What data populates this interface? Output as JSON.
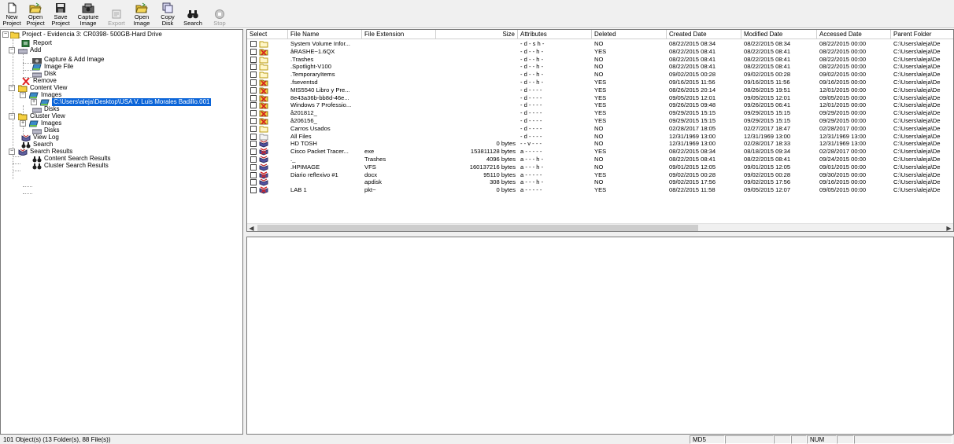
{
  "toolbar": {
    "buttons": [
      {
        "label": "New\nProject",
        "icon": "new-project-icon",
        "enabled": true
      },
      {
        "label": "Open\nProject",
        "icon": "open-project-icon",
        "enabled": true
      },
      {
        "label": "Save\nProject",
        "icon": "save-project-icon",
        "enabled": true
      },
      {
        "label": "Capture\nImage",
        "icon": "capture-image-icon",
        "enabled": true
      },
      {
        "label": "Export",
        "icon": "export-icon",
        "enabled": false
      },
      {
        "label": "Open\nImage",
        "icon": "open-image-icon",
        "enabled": true
      },
      {
        "label": "Copy\nDisk",
        "icon": "copy-disk-icon",
        "enabled": true
      },
      {
        "label": "Search",
        "icon": "binoculars-icon",
        "enabled": true
      },
      {
        "label": "Stop",
        "icon": "stop-icon",
        "enabled": false
      }
    ]
  },
  "tree": {
    "project": "Project - Evidencia 3: CR0398- 500GB-Hard Drive",
    "report": "Report",
    "add": "Add",
    "capture_add_image": "Capture & Add Image",
    "image_file": "Image File",
    "disk": "Disk",
    "remove": "Remove",
    "content_view": "Content View",
    "images": "Images",
    "selected_image": "C:\\Users\\aleja\\Desktop\\USA V. Luis Morales Badillo.001",
    "disks": "Disks",
    "cluster_view": "Cluster View",
    "cluster_images": "Images",
    "cluster_disks": "Disks",
    "view_log": "View Log",
    "search": "Search",
    "search_results": "Search Results",
    "content_search_results": "Content Search Results",
    "cluster_search_results": "Cluster Search Results"
  },
  "file_list": {
    "columns": [
      "Select",
      "File Name",
      "File Extension",
      "Size",
      "Attributes",
      "Deleted",
      "Created Date",
      "Modified Date",
      "Accessed Date",
      "Parent Folder"
    ],
    "rows": [
      {
        "icon": "folder",
        "name": "System Volume Infor...",
        "ext": "",
        "size": "",
        "attr": "- d - s h -",
        "deleted": "NO",
        "created": "08/22/2015 08:34",
        "modified": "08/22/2015 08:34",
        "accessed": "08/22/2015 00:00",
        "parent": "C:\\Users\\aleja\\De"
      },
      {
        "icon": "folder-deleted",
        "name": "åRASHE~1.6QX",
        "ext": "",
        "size": "",
        "attr": "- d - - h -",
        "deleted": "YES",
        "created": "08/22/2015 08:41",
        "modified": "08/22/2015 08:41",
        "accessed": "08/22/2015 00:00",
        "parent": "C:\\Users\\aleja\\De"
      },
      {
        "icon": "folder",
        "name": ".Trashes",
        "ext": "",
        "size": "",
        "attr": "- d - - h -",
        "deleted": "NO",
        "created": "08/22/2015 08:41",
        "modified": "08/22/2015 08:41",
        "accessed": "08/22/2015 00:00",
        "parent": "C:\\Users\\aleja\\De"
      },
      {
        "icon": "folder",
        "name": ".Spotlight-V100",
        "ext": "",
        "size": "",
        "attr": "- d - - h -",
        "deleted": "NO",
        "created": "08/22/2015 08:41",
        "modified": "08/22/2015 08:41",
        "accessed": "08/22/2015 00:00",
        "parent": "C:\\Users\\aleja\\De"
      },
      {
        "icon": "folder",
        "name": ".TemporaryItems",
        "ext": "",
        "size": "",
        "attr": "- d - - h -",
        "deleted": "NO",
        "created": "09/02/2015 00:28",
        "modified": "09/02/2015 00:28",
        "accessed": "09/02/2015 00:00",
        "parent": "C:\\Users\\aleja\\De"
      },
      {
        "icon": "folder-deleted",
        "name": ".fseventsd",
        "ext": "",
        "size": "",
        "attr": "- d - - h -",
        "deleted": "YES",
        "created": "09/16/2015 11:56",
        "modified": "09/16/2015 11:56",
        "accessed": "09/16/2015 00:00",
        "parent": "C:\\Users\\aleja\\De"
      },
      {
        "icon": "folder-deleted",
        "name": "MIS5540 Libro y Pre...",
        "ext": "",
        "size": "",
        "attr": "- d - - - -",
        "deleted": "YES",
        "created": "08/26/2015 20:14",
        "modified": "08/26/2015 19:51",
        "accessed": "12/01/2015 00:00",
        "parent": "C:\\Users\\aleja\\De"
      },
      {
        "icon": "folder-deleted",
        "name": "8e43a36b-bb8d-46e...",
        "ext": "",
        "size": "",
        "attr": "- d - - - -",
        "deleted": "YES",
        "created": "09/05/2015 12:01",
        "modified": "09/05/2015 12:01",
        "accessed": "09/05/2015 00:00",
        "parent": "C:\\Users\\aleja\\De"
      },
      {
        "icon": "folder-deleted",
        "name": "Windows 7 Professio...",
        "ext": "",
        "size": "",
        "attr": "- d - - - -",
        "deleted": "YES",
        "created": "09/26/2015 09:48",
        "modified": "09/26/2015 06:41",
        "accessed": "12/01/2015 00:00",
        "parent": "C:\\Users\\aleja\\De"
      },
      {
        "icon": "folder-deleted",
        "name": "å201812_",
        "ext": "",
        "size": "",
        "attr": "- d - - - -",
        "deleted": "YES",
        "created": "09/29/2015 15:15",
        "modified": "09/29/2015 15:15",
        "accessed": "09/29/2015 00:00",
        "parent": "C:\\Users\\aleja\\De"
      },
      {
        "icon": "folder-deleted",
        "name": "å206156_",
        "ext": "",
        "size": "",
        "attr": "- d - - - -",
        "deleted": "YES",
        "created": "09/29/2015 15:15",
        "modified": "09/29/2015 15:15",
        "accessed": "09/29/2015 00:00",
        "parent": "C:\\Users\\aleja\\De"
      },
      {
        "icon": "folder",
        "name": "Carros Usados",
        "ext": "",
        "size": "",
        "attr": "- d - - - -",
        "deleted": "NO",
        "created": "02/28/2017 18:05",
        "modified": "02/27/2017 18:47",
        "accessed": "02/28/2017 00:00",
        "parent": "C:\\Users\\aleja\\De"
      },
      {
        "icon": "folder-gray",
        "name": "All Files",
        "ext": "",
        "size": "",
        "attr": "- d - - - -",
        "deleted": "NO",
        "created": "12/31/1969 13:00",
        "modified": "12/31/1969 13:00",
        "accessed": "12/31/1969 13:00",
        "parent": "C:\\Users\\aleja\\De"
      },
      {
        "icon": "file",
        "name": "HD TOSH",
        "ext": "",
        "size": "0 bytes",
        "attr": "- - v - - -",
        "deleted": "NO",
        "created": "12/31/1969 13:00",
        "modified": "02/28/2017 18:33",
        "accessed": "12/31/1969 13:00",
        "parent": "C:\\Users\\aleja\\De"
      },
      {
        "icon": "file-deleted",
        "name": "Cisco Packet Tracer...",
        "ext": "exe",
        "size": "153811128 bytes",
        "attr": "a - - - - -",
        "deleted": "YES",
        "created": "08/22/2015 08:34",
        "modified": "08/18/2015 09:34",
        "accessed": "02/28/2017 00:00",
        "parent": "C:\\Users\\aleja\\De"
      },
      {
        "icon": "file",
        "name": "._",
        "ext": "Trashes",
        "size": "4096 bytes",
        "attr": "a - - - h -",
        "deleted": "NO",
        "created": "08/22/2015 08:41",
        "modified": "08/22/2015 08:41",
        "accessed": "09/24/2015 00:00",
        "parent": "C:\\Users\\aleja\\De"
      },
      {
        "icon": "file",
        "name": ".HPIMAGE",
        "ext": "VFS",
        "size": "160137216 bytes",
        "attr": "a - - - h -",
        "deleted": "NO",
        "created": "09/01/2015 12:05",
        "modified": "09/01/2015 12:05",
        "accessed": "09/01/2015 00:00",
        "parent": "C:\\Users\\aleja\\De"
      },
      {
        "icon": "file-deleted",
        "name": "Diario reflexivo #1",
        "ext": "docx",
        "size": "95110 bytes",
        "attr": "a - - - - -",
        "deleted": "YES",
        "created": "09/02/2015 00:28",
        "modified": "09/02/2015 00:28",
        "accessed": "09/30/2015 00:00",
        "parent": "C:\\Users\\aleja\\De"
      },
      {
        "icon": "file",
        "name": "",
        "ext": "apdisk",
        "size": "308 bytes",
        "attr": "a - - - h -",
        "deleted": "NO",
        "created": "09/02/2015 17:56",
        "modified": "09/02/2015 17:56",
        "accessed": "09/16/2015 00:00",
        "parent": "C:\\Users\\aleja\\De"
      },
      {
        "icon": "file-deleted",
        "name": "LAB 1",
        "ext": "pkt~",
        "size": "0 bytes",
        "attr": "a - - - - -",
        "deleted": "YES",
        "created": "08/22/2015 11:58",
        "modified": "09/05/2015 12:07",
        "accessed": "09/05/2015 00:00",
        "parent": "C:\\Users\\aleja\\De"
      }
    ]
  },
  "status": {
    "summary": "101 Object(s) (13 Folder(s), 88 File(s))",
    "md5": "MD5",
    "num": "NUM"
  },
  "colors": {
    "selection": "#0a64d8",
    "folder": "#f5d040",
    "deleted_mark": "#d42020",
    "chrome": "#f0f0f0"
  }
}
